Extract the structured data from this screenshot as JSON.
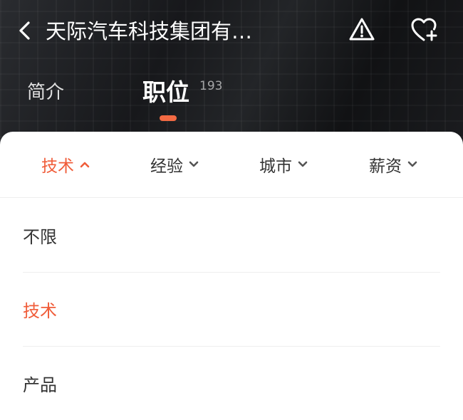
{
  "header": {
    "title": "天际汽车科技集团有…",
    "tabs": [
      {
        "label": "简介"
      },
      {
        "label": "职位",
        "count": "193",
        "active": true
      }
    ]
  },
  "filters": [
    {
      "label": "技术",
      "active": true,
      "icon": "chevron-up-icon"
    },
    {
      "label": "经验",
      "icon": "chevron-down-icon"
    },
    {
      "label": "城市",
      "icon": "chevron-down-icon"
    },
    {
      "label": "薪资",
      "icon": "chevron-down-icon"
    }
  ],
  "options": [
    {
      "label": "不限"
    },
    {
      "label": "技术",
      "selected": true
    },
    {
      "label": "产品"
    }
  ],
  "colors": {
    "accent": "#f05d3a",
    "header_bg": "#1b1c1f",
    "text_primary": "#333333"
  }
}
